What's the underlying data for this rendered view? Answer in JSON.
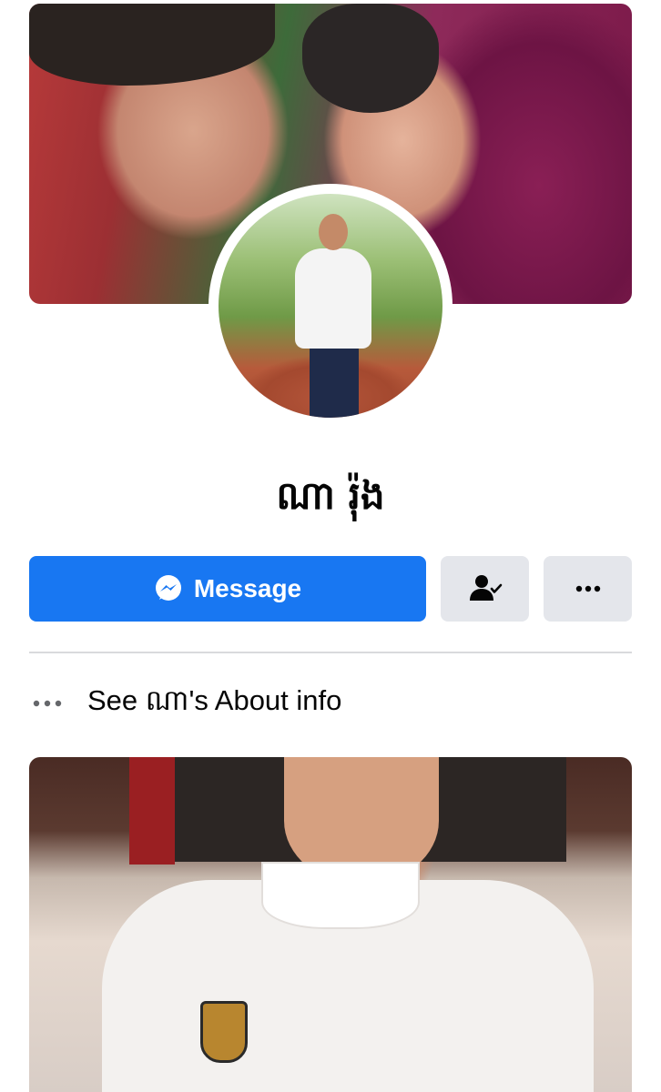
{
  "profile": {
    "name": "ណា រ៉ុង"
  },
  "actions": {
    "message_label": "Message",
    "message_icon": "messenger-icon",
    "friends_icon": "friends-check-icon",
    "more_icon": "more-dots-icon"
  },
  "about": {
    "text": "See ណា's About info",
    "icon": "more-dots-icon"
  },
  "colors": {
    "accent": "#1877f2",
    "secondary_button": "#e4e6eb",
    "text": "#050505",
    "divider": "#d9dadd"
  }
}
